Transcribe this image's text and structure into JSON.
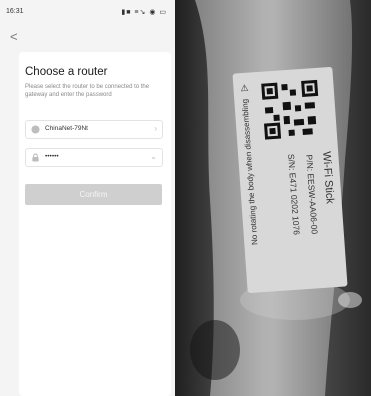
{
  "status_bar": {
    "time": "16:31",
    "icons": "▮■ ≡↘ ◉ ▭"
  },
  "nav": {
    "back_label": "<"
  },
  "router_page": {
    "title": "Choose a router",
    "subtitle": "Please select the router to be connected to the gateway and enter the password",
    "ssid_value": "ChinaNet-79Nt",
    "password_value": "••••••",
    "confirm_label": "Confirm"
  },
  "device_label": {
    "warning": "No rotating the body when disassembling",
    "product": "Wi-Fi Stick",
    "part_number": "P/N: EESW-AA06-00",
    "serial_number": "S/N: E471 0202 1076"
  }
}
